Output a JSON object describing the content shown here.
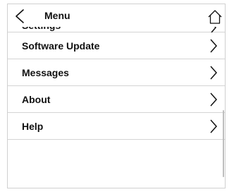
{
  "header": {
    "title": "Menu",
    "back_icon": "chevron-left-icon",
    "home_icon": "home-icon"
  },
  "menu": {
    "items": [
      {
        "label": "Settings",
        "icon": "chevron-right-icon"
      },
      {
        "label": "Software Update",
        "icon": "chevron-right-icon"
      },
      {
        "label": "Messages",
        "icon": "chevron-right-icon"
      },
      {
        "label": "About",
        "icon": "chevron-right-icon"
      },
      {
        "label": "Help",
        "icon": "chevron-right-icon"
      }
    ]
  },
  "colors": {
    "divider": "#d4d4d4",
    "text": "#111111",
    "scrollbar": "#bdbdbd"
  }
}
